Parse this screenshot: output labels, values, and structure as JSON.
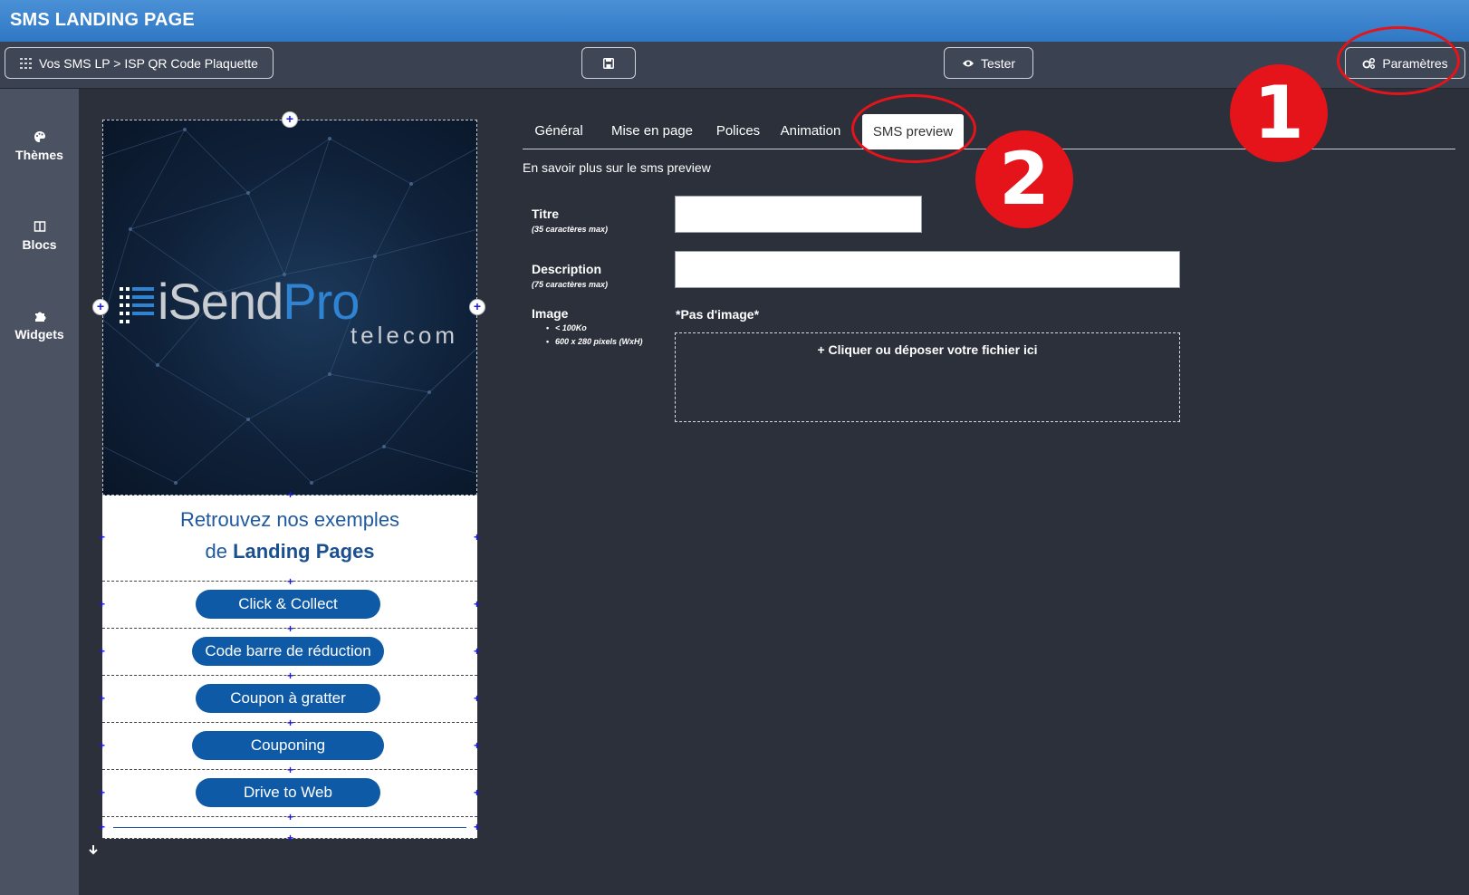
{
  "app": {
    "title": "SMS LANDING PAGE"
  },
  "toolbar": {
    "breadcrumb": "Vos SMS LP > ISP QR Code Plaquette",
    "test_label": "Tester",
    "settings_label": "Paramètres"
  },
  "sidebar": {
    "items": [
      {
        "label": "Thèmes",
        "icon": "palette-icon"
      },
      {
        "label": "Blocs",
        "icon": "columns-icon"
      },
      {
        "label": "Widgets",
        "icon": "puzzle-icon"
      }
    ]
  },
  "preview": {
    "logo": {
      "brand_a": "iSend",
      "brand_b": "Pro",
      "sub": "telecom"
    },
    "headline_line1": "Retrouvez nos exemples",
    "headline_de": "de",
    "headline_bold": "Landing Pages",
    "buttons": [
      "Click & Collect",
      "Code barre de réduction",
      "Coupon à gratter",
      "Couponing",
      "Drive to Web"
    ],
    "brand_color": "#0f5aa6"
  },
  "tabs": [
    {
      "label": "Général",
      "active": false
    },
    {
      "label": "Mise en page",
      "active": false
    },
    {
      "label": "Polices",
      "active": false
    },
    {
      "label": "Animation",
      "active": false
    },
    {
      "label": "SMS preview",
      "active": true
    }
  ],
  "sms_preview": {
    "info_link": "En savoir plus sur le sms preview",
    "title_label": "Titre",
    "title_hint": "(35 caractères max)",
    "title_value": "",
    "description_label": "Description",
    "description_hint": "(75 caractères max)",
    "description_value": "",
    "image_label": "Image",
    "image_hints": [
      "< 100Ko",
      "600 x 280 pixels (WxH)"
    ],
    "no_image": "*Pas d'image*",
    "dropzone_text": "+ Cliquer ou déposer votre fichier ici"
  },
  "annotations": {
    "marker_1": "1",
    "marker_2": "2",
    "color": "#e5141b"
  }
}
